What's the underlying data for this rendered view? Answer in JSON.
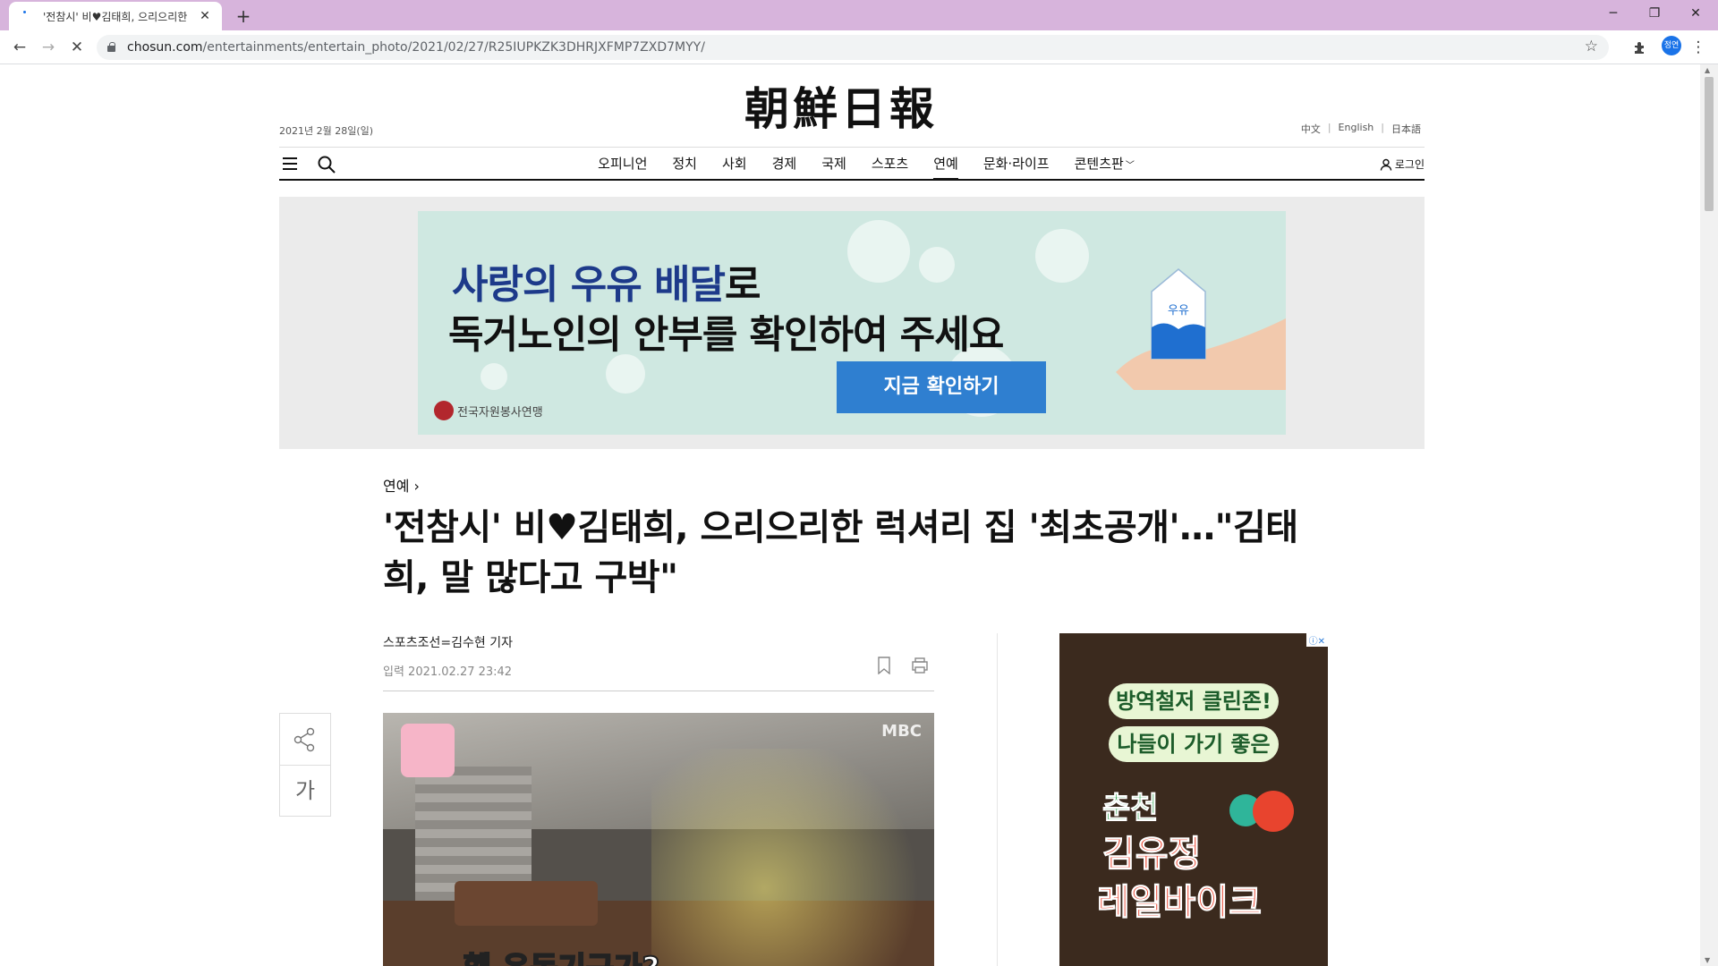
{
  "browser": {
    "tab_title": "'전참시' 비♥김태희, 으리으리한",
    "new_tab": "+",
    "url_domain": "chosun.com",
    "url_path": "/entertainments/entertain_photo/2021/02/27/R25IUPKZK3DHRJXFMP7ZXD7MYY/",
    "profile_label": "정연"
  },
  "header": {
    "masthead": "朝鮮日報",
    "date": "2021년 2월 28일(일)",
    "languages": [
      "中文",
      "English",
      "日本語"
    ],
    "nav": [
      "오피니언",
      "정치",
      "사회",
      "경제",
      "국제",
      "스포츠",
      "연예",
      "문화·라이프",
      "콘텐츠판"
    ],
    "active_nav": "연예",
    "login": "로그인"
  },
  "top_ad": {
    "line1_highlight": "사랑의 우유 배달",
    "line1_rest": "로",
    "line2": "독거노인의 안부를 확인하여 주세요",
    "cta": "지금 확인하기",
    "org": "전국자원봉사연맹",
    "carton_label": "우유"
  },
  "article": {
    "section": "연예",
    "headline": "'전참시' 비♥김태희, 으리으리한 럭셔리 집 '최초공개'…\"김태희, 말 많다고 구박\"",
    "byline": "스포츠조선=김수현 기자",
    "published": "입력 2021.02.27 23:42",
    "photo_logo": "MBC",
    "photo_caption": "헬 운동기구가?"
  },
  "share": {
    "font_size_label": "가"
  },
  "side_ad": {
    "line1": "방역철저 클린존!",
    "line2": "나들이 가기 좋은",
    "line3": "춘천",
    "line4": "김유정",
    "line5": "레일바이크"
  },
  "colors": {
    "tabbar": "#d7b4dc",
    "ad_bg": "#cfe8e1",
    "ad_cta": "#2f7fd0"
  }
}
